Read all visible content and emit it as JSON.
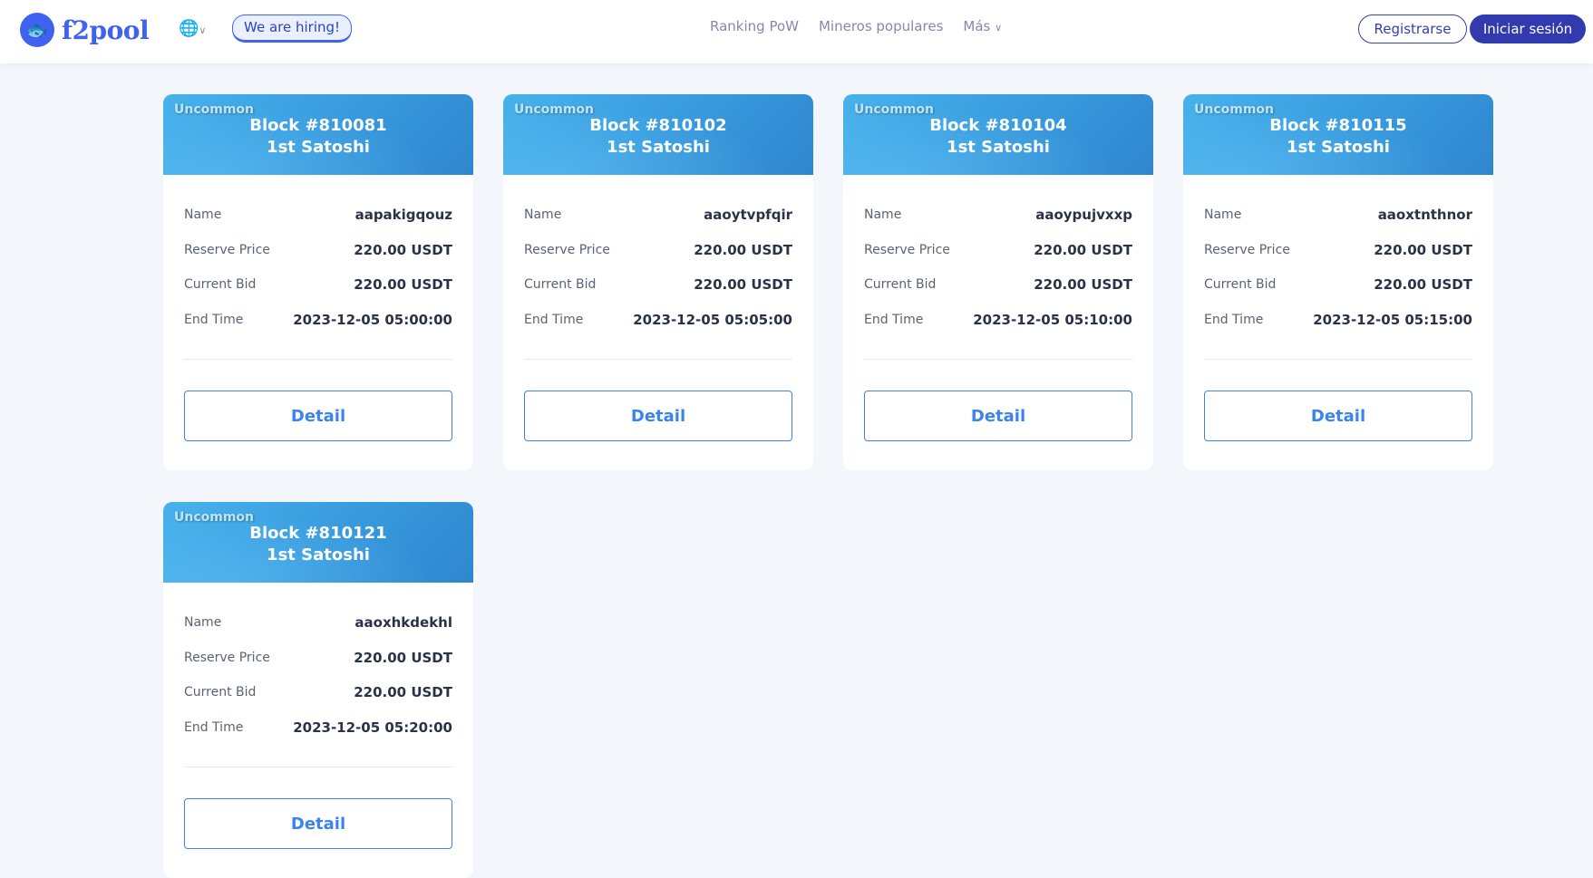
{
  "header": {
    "logo": "f2pool",
    "hiring": "We are hiring!",
    "nav": [
      "Ranking PoW",
      "Mineros populares",
      "Más"
    ],
    "register": "Registrarse",
    "login": "Iniciar sesión"
  },
  "labels": {
    "name": "Name",
    "reserve": "Reserve Price",
    "bid": "Current Bid",
    "end": "End Time",
    "detail": "Detail"
  },
  "cards": [
    {
      "rarity": "Uncommon",
      "block": "Block #810081",
      "sat": "1st Satoshi",
      "name": "aapakigqouz",
      "reserve": "220.00 USDT",
      "bid": "220.00 USDT",
      "end": "2023-12-05 05:00:00"
    },
    {
      "rarity": "Uncommon",
      "block": "Block #810102",
      "sat": "1st Satoshi",
      "name": "aaoytvpfqir",
      "reserve": "220.00 USDT",
      "bid": "220.00 USDT",
      "end": "2023-12-05 05:05:00"
    },
    {
      "rarity": "Uncommon",
      "block": "Block #810104",
      "sat": "1st Satoshi",
      "name": "aaoypujvxxp",
      "reserve": "220.00 USDT",
      "bid": "220.00 USDT",
      "end": "2023-12-05 05:10:00"
    },
    {
      "rarity": "Uncommon",
      "block": "Block #810115",
      "sat": "1st Satoshi",
      "name": "aaoxtnthnor",
      "reserve": "220.00 USDT",
      "bid": "220.00 USDT",
      "end": "2023-12-05 05:15:00"
    },
    {
      "rarity": "Uncommon",
      "block": "Block #810121",
      "sat": "1st Satoshi",
      "name": "aaoxhkdekhl",
      "reserve": "220.00 USDT",
      "bid": "220.00 USDT",
      "end": "2023-12-05 05:20:00"
    }
  ]
}
